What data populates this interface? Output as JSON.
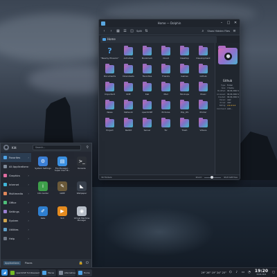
{
  "file_manager": {
    "title": "Home — Dolphin",
    "toolbar": {
      "split_label": "Split",
      "filter_label": "Show Hidden Files"
    },
    "tab_label": "Home",
    "items": [
      {
        "label": "\"Beamy Phoenix\"",
        "icon": "question-mark-icon"
      },
      {
        "label": "Activities",
        "icon": "folder-icon"
      },
      {
        "label": "Bookmark",
        "icon": "folder-icon"
      },
      {
        "label": "Cloud",
        "icon": "folder-icon"
      },
      {
        "label": "Desktop",
        "icon": "folder-icon"
      },
      {
        "label": "Development",
        "icon": "folder-icon"
      },
      {
        "label": "Documents",
        "icon": "folder-icon"
      },
      {
        "label": "Downloads",
        "icon": "folder-icon"
      },
      {
        "label": "Favorites",
        "icon": "folder-icon"
      },
      {
        "label": "Friends",
        "icon": "folder-icon"
      },
      {
        "label": "Games",
        "icon": "folder-icon"
      },
      {
        "label": "Github",
        "icon": "folder-icon"
      },
      {
        "label": "Important",
        "icon": "folder-icon"
      },
      {
        "label": "KDE",
        "icon": "folder-icon"
      },
      {
        "label": "Kali",
        "icon": "folder-icon"
      },
      {
        "label": "Mail",
        "icon": "folder-icon"
      },
      {
        "label": "Mockups",
        "icon": "folder-icon"
      },
      {
        "label": "Music",
        "icon": "folder-icon"
      },
      {
        "label": "News",
        "icon": "folder-icon"
      },
      {
        "label": "Network",
        "icon": "folder-icon"
      },
      {
        "label": "openSUSE",
        "icon": "folder-icon"
      },
      {
        "label": "Pictures",
        "icon": "folder-icon"
      },
      {
        "label": "Pop_OS",
        "icon": "folder-icon"
      },
      {
        "label": "Printer",
        "icon": "folder-icon"
      },
      {
        "label": "Project",
        "icon": "folder-icon"
      },
      {
        "label": "Reddit",
        "icon": "folder-icon"
      },
      {
        "label": "Server",
        "icon": "folder-icon"
      },
      {
        "label": "Tor",
        "icon": "folder-icon"
      },
      {
        "label": "Trash",
        "icon": "folder-icon"
      },
      {
        "label": "Videos",
        "icon": "folder-icon"
      }
    ],
    "info_panel": {
      "name": "Github",
      "rows": [
        {
          "key": "Type:",
          "value": "Folder"
        },
        {
          "key": "Size:",
          "value": "7 items"
        },
        {
          "key": "Modified:",
          "value": "09.04.2022 18:43"
        },
        {
          "key": "Accessed:",
          "value": "09.04.2022 18:43"
        },
        {
          "key": "Created:",
          "value": "09.04.2022 18:43"
        },
        {
          "key": "Owner:",
          "value": "user"
        },
        {
          "key": "Group:",
          "value": "user"
        },
        {
          "key": "Rating:",
          "value": "★★★★★"
        },
        {
          "key": "Comment:",
          "value": "Add..."
        }
      ]
    },
    "status": {
      "items": "30 Folders",
      "zoom": "Zoom:",
      "free": "99,8 GiB free"
    }
  },
  "launcher": {
    "user": "Kitt",
    "search_placeholder": "Search...",
    "categories": [
      {
        "label": "Favorites",
        "color": "#4fa3e6",
        "active": true
      },
      {
        "label": "All Applications",
        "color": "#7f8a99"
      },
      {
        "label": "Graphics",
        "color": "#e06c9f"
      },
      {
        "label": "Internet",
        "color": "#3fb6d9"
      },
      {
        "label": "Multimedia",
        "color": "#e0875a"
      },
      {
        "label": "Office",
        "color": "#4fbf7a"
      },
      {
        "label": "Settings",
        "color": "#9a7fd1"
      },
      {
        "label": "System",
        "color": "#d1a64f"
      },
      {
        "label": "Utilities",
        "color": "#5fa0c9"
      },
      {
        "label": "Help",
        "color": "#6f7886"
      }
    ],
    "apps": [
      {
        "label": "System Settings",
        "color": "#3b7fd6",
        "glyph": "⚙"
      },
      {
        "label": "File Manager - Super User M...",
        "color": "#3a8fe0",
        "glyph": "▤"
      },
      {
        "label": "Konsole",
        "color": "#2b2f36",
        "glyph": ">_"
      },
      {
        "label": "Info Center",
        "color": "#3e9f4a",
        "glyph": "i"
      },
      {
        "label": "GIMP",
        "color": "#6b5a3a",
        "glyph": "✎"
      },
      {
        "label": "Wallpaper",
        "color": "#38404c",
        "glyph": "◣"
      },
      {
        "label": "Kate",
        "color": "#2f7fd0",
        "glyph": "✐"
      },
      {
        "label": "VLC",
        "color": "#e58b1f",
        "glyph": "▶"
      },
      {
        "label": "Virtual Machine Manager",
        "color": "#b8bec8",
        "glyph": "◉"
      }
    ],
    "footer": {
      "applications": "Applications",
      "places": "Places"
    }
  },
  "taskbar": {
    "tasks": [
      {
        "label": "openSUSE Tumbleweed KDE 5.24",
        "color": "#73ba25"
      },
      {
        "label": "Places",
        "color": "#4fa3e6"
      },
      {
        "label": "Alternative",
        "color": "#7f8a99"
      },
      {
        "label": "Home",
        "color": "#4fa3e6"
      }
    ],
    "weather": "29° 26° 19° 24° 25°",
    "time": "19:20",
    "date": "09.04.2022"
  }
}
